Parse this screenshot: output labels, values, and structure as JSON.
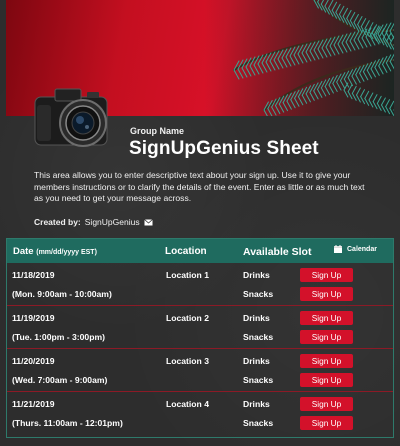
{
  "header": {
    "group_label": "Group Name",
    "title": "SignUpGenius Sheet",
    "description": "This area allows you to enter descriptive text about your sign up. Use it to give your members instructions or to clarify the details of the event. Enter as little or as much text as you need to get your message across.",
    "created_by_label": "Created by:",
    "created_by_name": "SignUpGenius"
  },
  "table": {
    "headers": {
      "date": "Date",
      "date_format": "(mm/dd/yyyy EST)",
      "location": "Location",
      "slot": "Available Slot",
      "calendar": "Calendar"
    },
    "rows": [
      {
        "date": "11/18/2019",
        "time": "(Mon. 9:00am - 10:00am)",
        "location": "Location 1",
        "slots": [
          {
            "name": "Drinks",
            "button": "Sign Up"
          },
          {
            "name": "Snacks",
            "button": "Sign Up"
          }
        ]
      },
      {
        "date": "11/19/2019",
        "time": "(Tue. 1:00pm - 3:00pm)",
        "location": "Location 2",
        "slots": [
          {
            "name": "Drinks",
            "button": "Sign Up"
          },
          {
            "name": "Snacks",
            "button": "Sign Up"
          }
        ]
      },
      {
        "date": "11/20/2019",
        "time": "(Wed. 7:00am - 9:00am)",
        "location": "Location 3",
        "slots": [
          {
            "name": "Drinks",
            "button": "Sign Up"
          },
          {
            "name": "Snacks",
            "button": "Sign Up"
          }
        ]
      },
      {
        "date": "11/21/2019",
        "time": "(Thurs. 11:00am - 12:01pm)",
        "location": "Location 4",
        "slots": [
          {
            "name": "Drinks",
            "button": "Sign Up"
          },
          {
            "name": "Snacks",
            "button": "Sign Up"
          }
        ]
      }
    ]
  },
  "colors": {
    "accent_teal": "#1f6b5f",
    "button_red": "#d3112a",
    "banner_red": "#d81128",
    "background": "#2d2d2d"
  },
  "icons": [
    "camera-image",
    "mail-icon",
    "calendar-icon",
    "pine-branch-image"
  ]
}
